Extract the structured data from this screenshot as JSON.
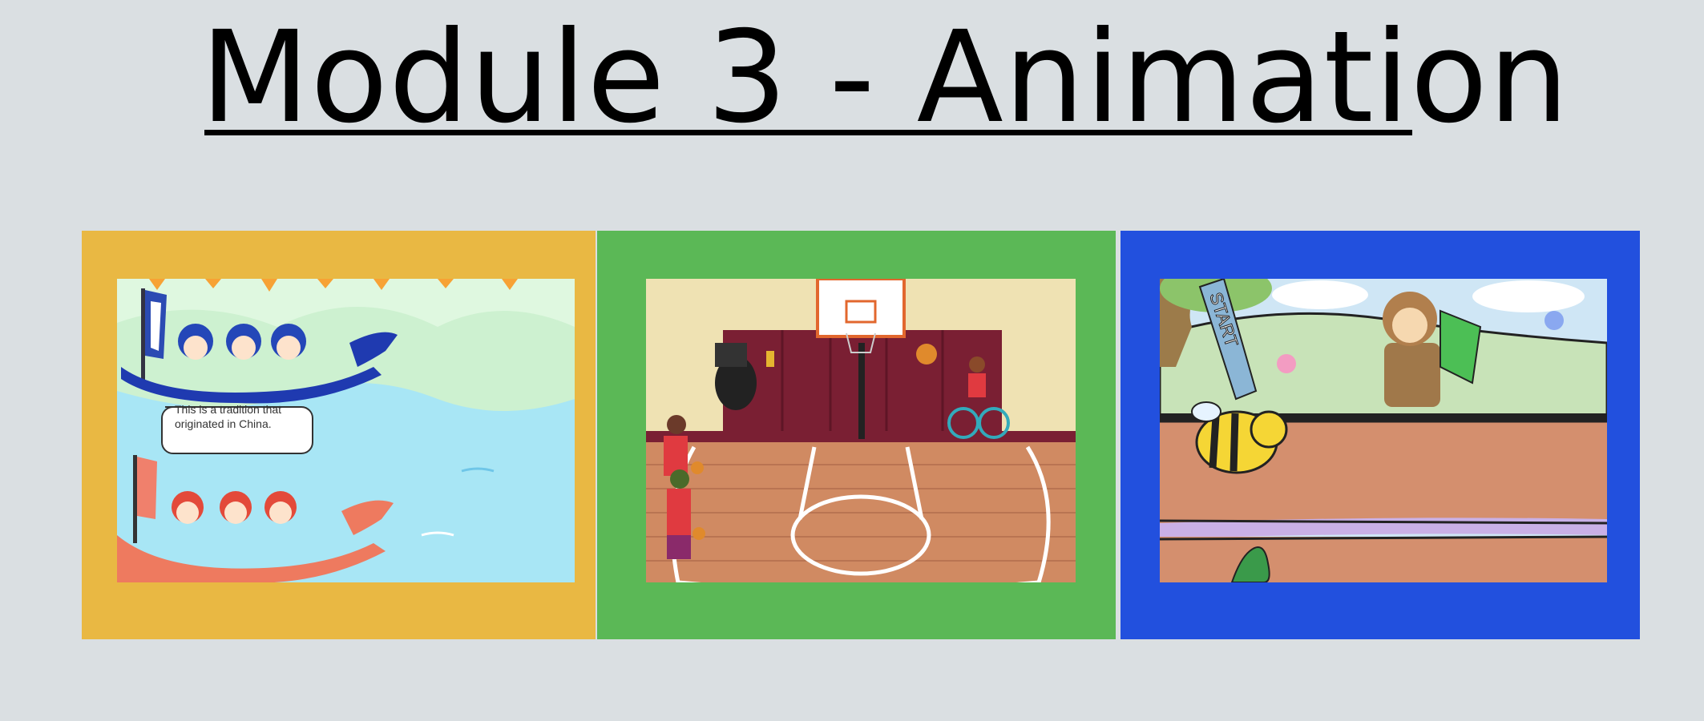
{
  "slide": {
    "title": "Module 3 - Animation",
    "panels": [
      {
        "name": "dragon-boat",
        "bg": "#e9b843",
        "caption": "This is a tradition that originated in China."
      },
      {
        "name": "basketball",
        "bg": "#5bb856"
      },
      {
        "name": "race",
        "bg": "#2250de",
        "sign": "START"
      }
    ]
  }
}
